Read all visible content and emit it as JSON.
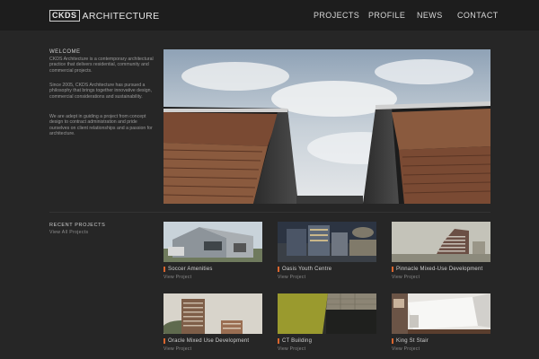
{
  "header": {
    "logo_box": "CKDS",
    "logo_word": "ARCHITECTURE",
    "nav": [
      "PROJECTS",
      "PROFILE",
      "NEWS",
      "CONTACT"
    ]
  },
  "welcome": {
    "title": "WELCOME",
    "paragraphs": [
      "CKDS Architecture is a contemporary architectural practice that delivers residential, community and commercial projects.",
      "Since 2005, CKDS Architecture has pursued a philosophy that brings together innovative design, commercial considerations and sustainability.",
      "We are adept in guiding a project from concept design to contract administration and pride ourselves on client relationships and a passion for architecture."
    ]
  },
  "recent": {
    "title": "RECENT PROJECTS",
    "view_all": "View All Projects",
    "view_label": "View Project",
    "projects": [
      {
        "name": "Soccer Amenities"
      },
      {
        "name": "Oasis Youth Centre"
      },
      {
        "name": "Pinnacle Mixed-Use Development"
      },
      {
        "name": "Oracle Mixed Use Development"
      },
      {
        "name": "CT Building"
      },
      {
        "name": "King St Stair"
      }
    ]
  },
  "colors": {
    "background": "#262626",
    "header": "#1d1d1d",
    "accent": "#d9652e"
  }
}
